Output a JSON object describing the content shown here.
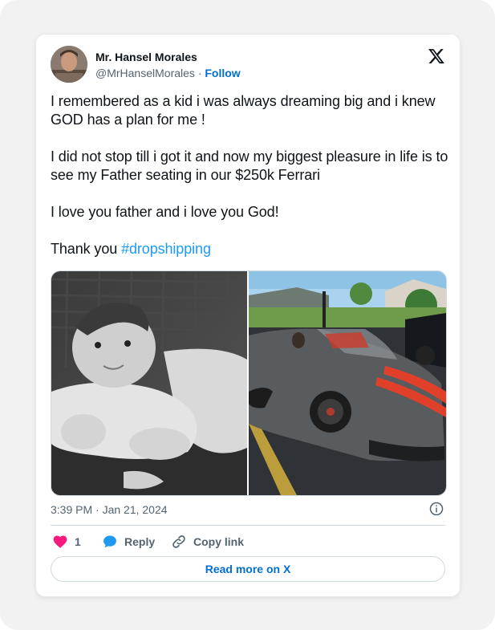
{
  "author": {
    "name": "Mr. Hansel Morales",
    "handle": "@MrHanselMorales",
    "separator": "·",
    "follow_label": "Follow"
  },
  "tweet": {
    "paragraphs": [
      "I remembered as a kid i was always dreaming big and i knew GOD has a plan for me !",
      "I did not stop till i got it and now my biggest pleasure in life is to see my Father seating in our $250k Ferrari",
      "I love you father and i love you God!"
    ],
    "thanks_prefix": "Thank you ",
    "hashtag": "#dropshipping"
  },
  "media": {
    "left_photo": "baby-photo",
    "right_photo": "ferrari-photo"
  },
  "meta": {
    "timestamp": "3:39 PM · Jan 21, 2024"
  },
  "actions": {
    "like_count": "1",
    "reply_label": "Reply",
    "copy_label": "Copy link"
  },
  "read_more_label": "Read more on X",
  "colors": {
    "accent": "#006fd6",
    "hashtag": "#1d9bf0",
    "like": "#f91880",
    "text": "#0f1419",
    "muted": "#536471"
  },
  "icons": [
    "x-logo-icon",
    "info-icon",
    "heart-icon",
    "reply-bubble-icon",
    "link-icon"
  ]
}
